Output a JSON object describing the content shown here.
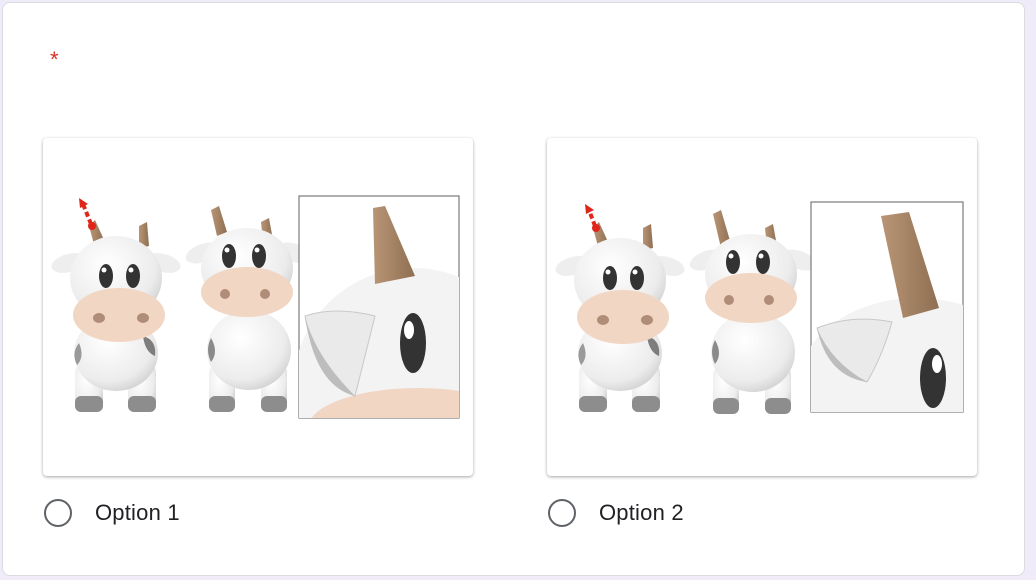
{
  "question": {
    "required_marker": "*"
  },
  "options": [
    {
      "label": "Option 1",
      "image_icon": "cow-render-arrow-horn-image",
      "selected": false
    },
    {
      "label": "Option 2",
      "image_icon": "cow-render-arrow-horn-image",
      "selected": false
    }
  ],
  "colors": {
    "page_bg": "#f0ebf8",
    "card_bg": "#ffffff",
    "required": "#d93025",
    "radio_border": "#5f6368",
    "label_text": "#202124",
    "arrow": "#e0261b",
    "horn": "#a88667",
    "muzzle": "#f1d6c4",
    "nostril": "#b08d78",
    "body": "#f4f4f4",
    "spot": "#7a7a7a"
  }
}
